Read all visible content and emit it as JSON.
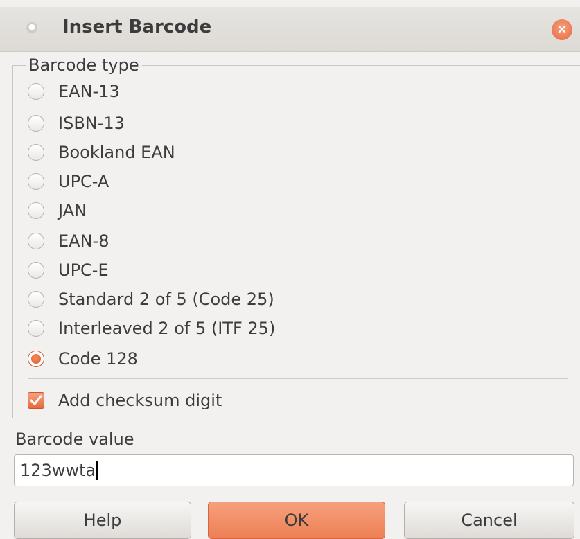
{
  "dialog": {
    "title": "Insert Barcode",
    "close_glyph": "×"
  },
  "barcode_type": {
    "legend": "Barcode type",
    "options": [
      {
        "label": "EAN-13",
        "checked": false
      },
      {
        "label": "ISBN-13",
        "checked": false
      },
      {
        "label": "Bookland EAN",
        "checked": false
      },
      {
        "label": "UPC-A",
        "checked": false
      },
      {
        "label": "JAN",
        "checked": false
      },
      {
        "label": "EAN-8",
        "checked": false
      },
      {
        "label": "UPC-E",
        "checked": false
      },
      {
        "label": "Standard 2 of 5 (Code 25)",
        "checked": false
      },
      {
        "label": "Interleaved 2 of 5 (ITF 25)",
        "checked": false
      },
      {
        "label": "Code 128",
        "checked": true
      }
    ],
    "checksum_label": "Add checksum digit",
    "checksum_checked": true
  },
  "value": {
    "label": "Barcode value",
    "text": "123wwta"
  },
  "buttons": {
    "help": "Help",
    "ok": "OK",
    "cancel": "Cancel"
  },
  "colors": {
    "accent": "#e8693f",
    "background": "#f2f1f0"
  }
}
